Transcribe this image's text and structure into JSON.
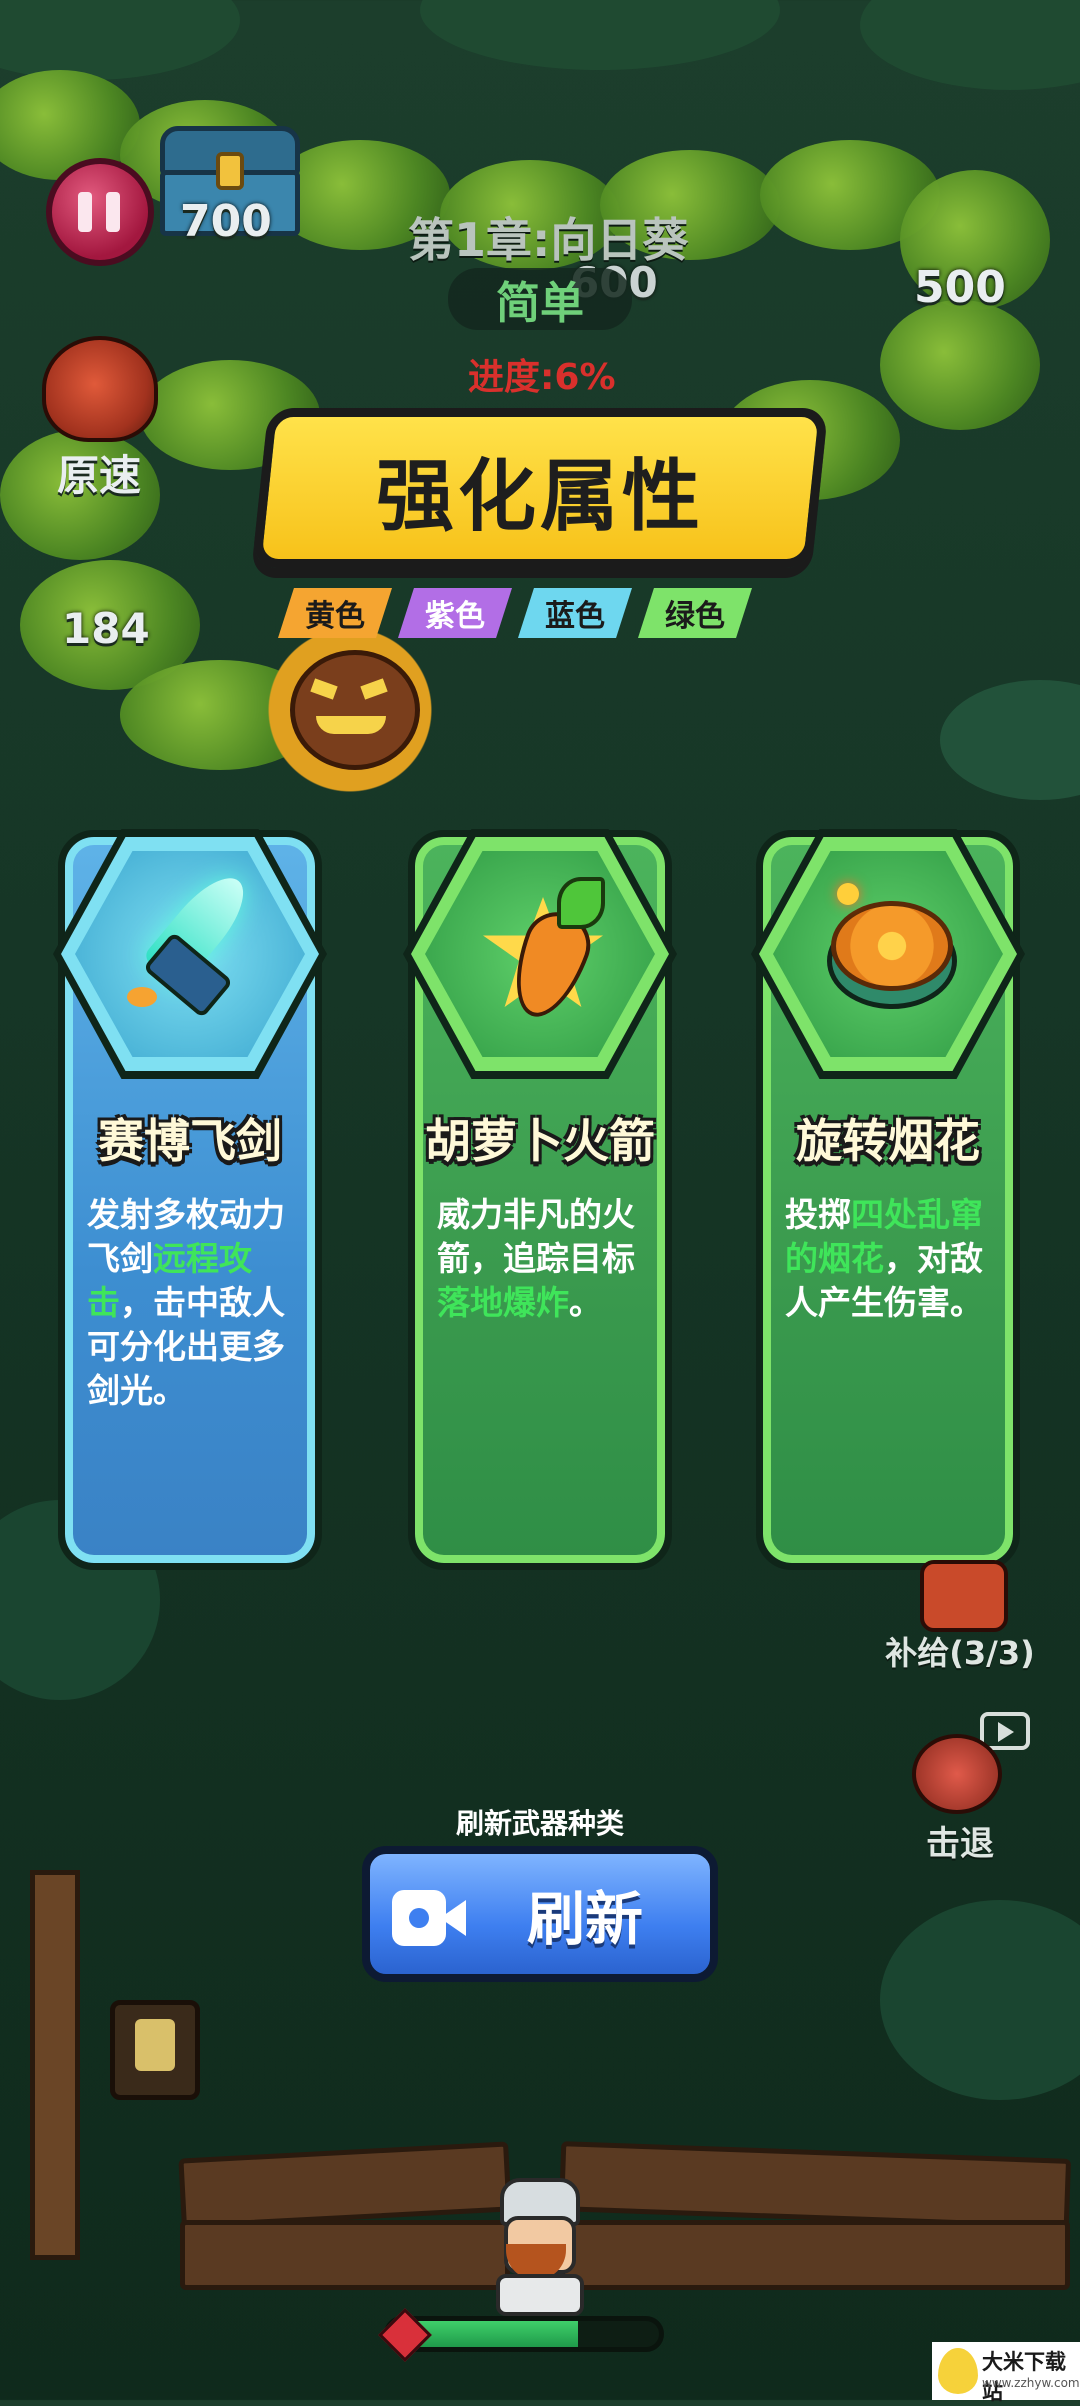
{
  "hud": {
    "chest_count": "700",
    "chapter_title": "第1章:向日葵",
    "difficulty": "简单",
    "progress": "进度:6%",
    "speed_label": "原速",
    "float_600": "600",
    "float_500": "500",
    "float_184": "184"
  },
  "panel": {
    "title": "强化属性",
    "color_tags": [
      {
        "label": "黄色",
        "color": "#f5a531"
      },
      {
        "label": "紫色",
        "color": "#b26ee6"
      },
      {
        "label": "蓝色",
        "color": "#6ed7ef"
      },
      {
        "label": "绿色",
        "color": "#7ee36a"
      }
    ]
  },
  "cards": [
    {
      "name": "赛博飞剑",
      "icon": "cyber-flying-sword-icon",
      "desc": [
        {
          "text": "发射多枚动力飞剑",
          "hl": false
        },
        {
          "text": "远程攻击",
          "hl": true
        },
        {
          "text": "，击中敌人可分化出更多剑光。",
          "hl": false
        }
      ],
      "theme": "blue"
    },
    {
      "name": "胡萝卜火箭",
      "icon": "carrot-rocket-icon",
      "desc": [
        {
          "text": "威力非凡的火箭，追踪目标",
          "hl": false
        },
        {
          "text": "落地爆炸",
          "hl": true
        },
        {
          "text": "。",
          "hl": false
        }
      ],
      "theme": "green"
    },
    {
      "name": "旋转烟花",
      "icon": "spinning-firework-icon",
      "desc": [
        {
          "text": "投掷",
          "hl": false
        },
        {
          "text": "四处乱窜的烟花",
          "hl": true
        },
        {
          "text": "，对敌人产生伤害。",
          "hl": false
        }
      ],
      "theme": "green"
    }
  ],
  "side": {
    "supply_label": "补给(3/3)",
    "knockback_label": "击退"
  },
  "refresh": {
    "caption": "刷新武器种类",
    "label": "刷新"
  },
  "player": {
    "health": 0.7
  },
  "watermark": {
    "text": "大米下载站",
    "url_text": "www.zzhyw.com"
  }
}
